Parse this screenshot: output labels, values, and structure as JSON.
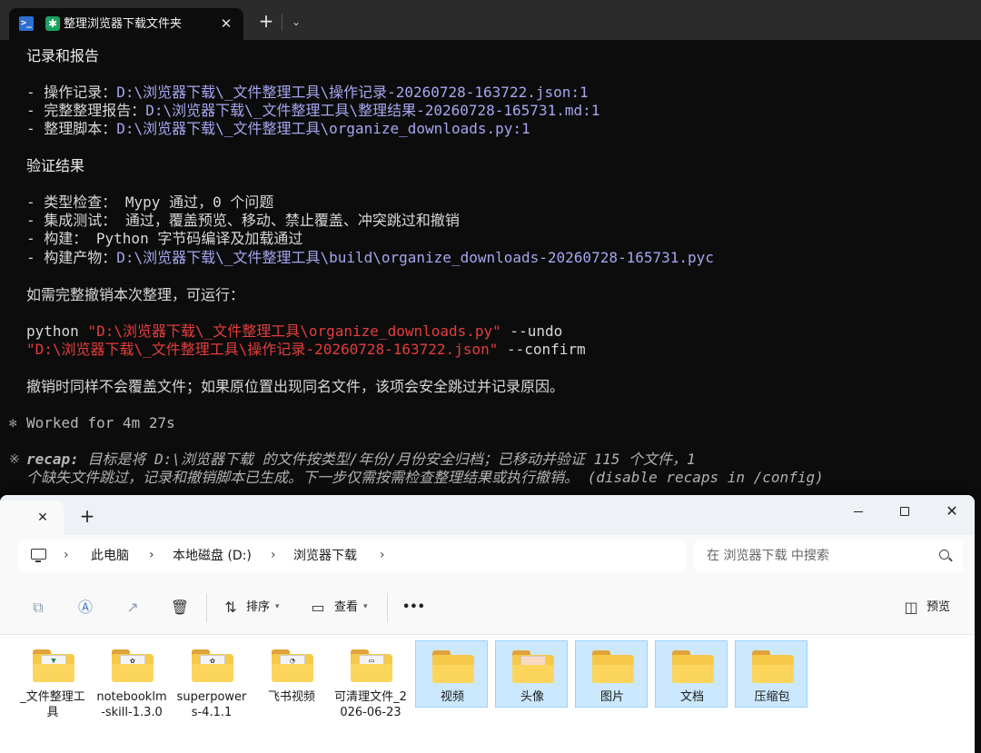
{
  "terminal": {
    "tab_title": "整理浏览器下载文件夹",
    "lines": {
      "h1": "记录和报告",
      "l1a": "- 操作记录：",
      "l1b": "D:\\浏览器下载\\_文件整理工具\\操作记录-20260728-163722.json:1",
      "l2a": "- 完整整理报告：",
      "l2b": "D:\\浏览器下载\\_文件整理工具\\整理结果-20260728-165731.md:1",
      "l3a": "- 整理脚本：",
      "l3b": "D:\\浏览器下载\\_文件整理工具\\organize_downloads.py:1",
      "h2": "验证结果",
      "v1": "- 类型检查： Mypy 通过，0 个问题",
      "v2": "- 集成测试： 通过，覆盖预览、移动、禁止覆盖、冲突跳过和撤销",
      "v3": "- 构建： Python 字节码编译及加载通过",
      "v4a": "- 构建产物：",
      "v4b": "D:\\浏览器下载\\_文件整理工具\\build\\organize_downloads-20260728-165731.pyc",
      "undo_intro": "如需完整撤销本次整理，可运行：",
      "cmd1a": "python ",
      "cmd1b": "\"D:\\浏览器下载\\_文件整理工具\\organize_downloads.py\"",
      "cmd1c": " --undo",
      "cmd2a": "\"D:\\浏览器下载\\_文件整理工具\\操作记录-20260728-163722.json\"",
      "cmd2b": " --confirm",
      "note": "撤销时同样不会覆盖文件；如果原位置出现同名文件，该项会安全跳过并记录原因。",
      "worked": "Worked for 4m 27s",
      "recap_key": "recap:",
      "recap1": " 目标是将 D:\\浏览器下载 的文件按类型/年份/月份安全归档；已移动并验证 115 个文件，1",
      "recap2": "个缺失文件跳过，记录和撤销脚本已生成。下一步仅需按需检查整理结果或执行撤销。 (disable recaps in /config)"
    }
  },
  "explorer": {
    "breadcrumb": [
      "此电脑",
      "本地磁盘 (D:)",
      "浏览器下载"
    ],
    "search_placeholder": "在 浏览器下载 中搜索",
    "toolbar": {
      "sort_label": "排序",
      "view_label": "查看",
      "more_label": "•••",
      "preview_label": "预览"
    },
    "items": [
      {
        "label": "_文件整理工具",
        "selected": false
      },
      {
        "label": "notebooklm-skill-1.3.0",
        "selected": false
      },
      {
        "label": "superpowers-4.1.1",
        "selected": false
      },
      {
        "label": "飞书视频",
        "selected": false
      },
      {
        "label": "可清理文件_2026-06-23",
        "selected": false
      },
      {
        "label": "视频",
        "selected": true
      },
      {
        "label": "头像",
        "selected": true
      },
      {
        "label": "图片",
        "selected": true
      },
      {
        "label": "文档",
        "selected": true
      },
      {
        "label": "压缩包",
        "selected": true
      }
    ]
  }
}
